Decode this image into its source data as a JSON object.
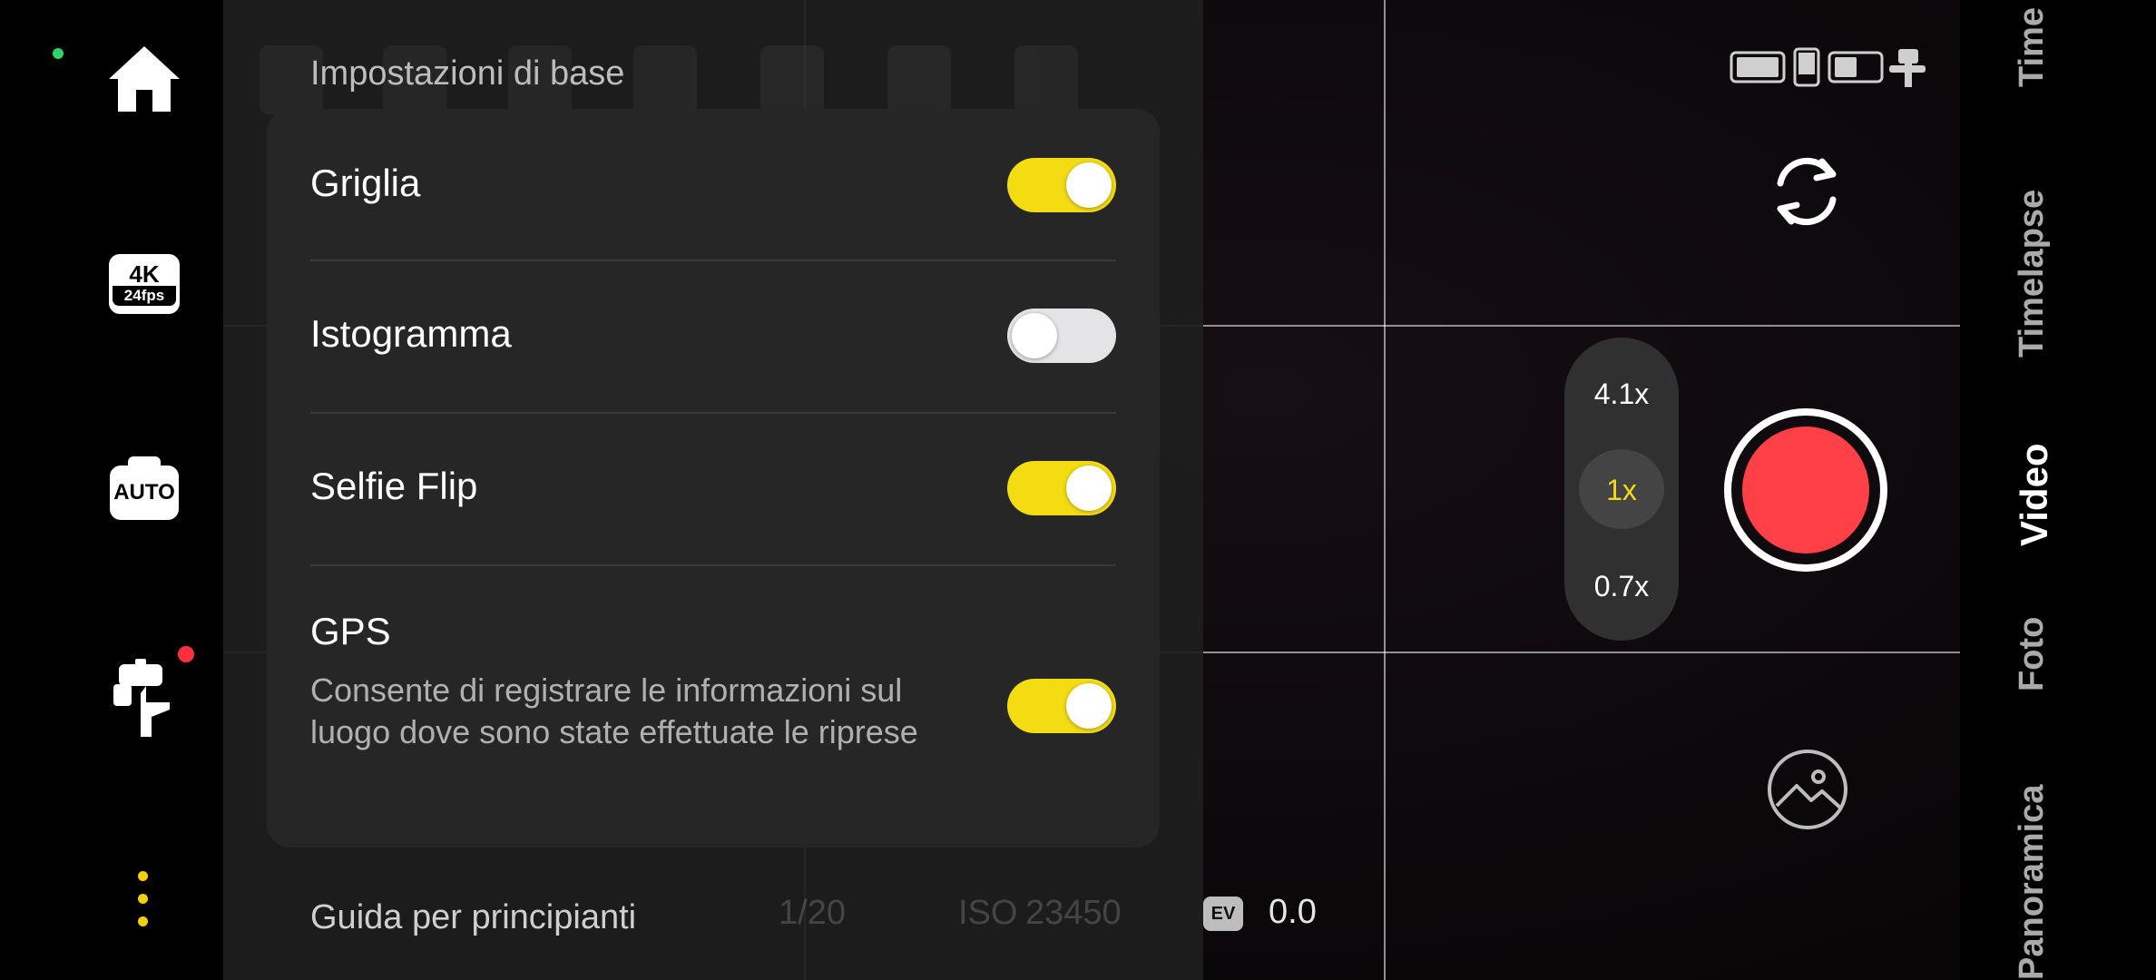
{
  "settings": {
    "section_title": "Impostazioni di base",
    "items": [
      {
        "label": "Griglia",
        "enabled": true
      },
      {
        "label": "Istogramma",
        "enabled": false
      },
      {
        "label": "Selfie Flip",
        "enabled": true
      },
      {
        "label": "GPS",
        "enabled": true,
        "description": "Consente di registrare le informazioni sul luogo dove sono state effettuate le riprese"
      }
    ],
    "footer_link": "Guida per principianti"
  },
  "left_rail": {
    "resolution": "4K",
    "framerate": "24fps",
    "camera_mode": "AUTO",
    "icons": [
      "home-icon",
      "resolution-badge",
      "auto-mode-icon",
      "gimbal-icon",
      "more-icon"
    ]
  },
  "exposure": {
    "shutter": "1/20",
    "iso_label": "ISO",
    "iso": "23450",
    "ev_label": "EV",
    "ev_value": "0.0"
  },
  "zoom": {
    "options": [
      "4.1x",
      "1x",
      "0.7x"
    ],
    "selected": "1x"
  },
  "modes": [
    "Time",
    "Timelapse",
    "Video",
    "Foto",
    "Panoramica"
  ],
  "active_mode": "Video",
  "colors": {
    "accent": "#f3dc12",
    "record": "#ff4046",
    "notification": "#ff2f3f",
    "status_led": "#2bd46b"
  }
}
